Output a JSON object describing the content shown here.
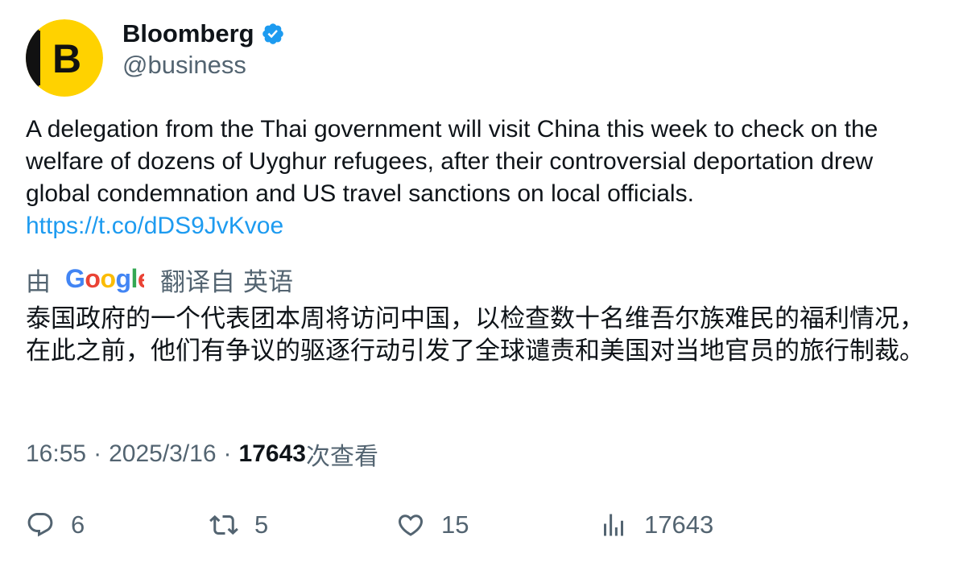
{
  "author": {
    "name": "Bloomberg",
    "handle": "@business",
    "avatar_letter": "B",
    "verified_icon": "verified-badge-icon"
  },
  "tweet": {
    "text": "A delegation from the Thai government will visit China this week to check on the welfare of dozens of Uyghur refugees, after their controversial deportation drew global condemnation and US travel sanctions on local officials.",
    "link": "https://t.co/dDS9JvKvoe"
  },
  "translation": {
    "prefix": "由",
    "provider": "Google",
    "translated_from": "翻译自",
    "language": "英语",
    "text": "泰国政府的一个代表团本周将访问中国，以检查数十名维吾尔族难民的福利情况，在此之前，他们有争议的驱逐行动引发了全球谴责和美国对当地官员的旅行制裁。"
  },
  "meta": {
    "time": "16:55",
    "separator": "·",
    "date": "2025/3/16",
    "views_count": "17643",
    "views_label": "次查看"
  },
  "actions": {
    "replies": "6",
    "retweets": "5",
    "likes": "15",
    "views": "17643"
  },
  "colors": {
    "brand_yellow": "#ffd200",
    "link_blue": "#1d9bf0",
    "secondary_text": "#536471",
    "primary_text": "#0f1419"
  }
}
